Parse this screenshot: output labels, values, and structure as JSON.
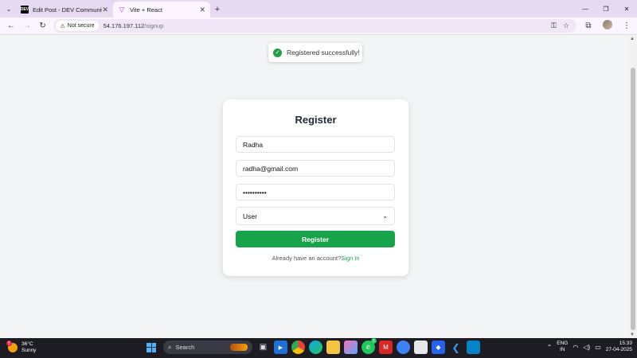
{
  "browser": {
    "tabs": [
      {
        "title": "Edit Post - DEV Community",
        "favicon": "DEV"
      },
      {
        "title": "Vite + React",
        "favicon": "vite-icon"
      }
    ],
    "address": {
      "security_label": "Not secure",
      "host": "54.176.197.112",
      "path": "/signup"
    }
  },
  "toast": {
    "message": "Registered successfully!"
  },
  "form": {
    "title": "Register",
    "name_value": "Radha",
    "email_value": "radha@gmail.com",
    "password_value": "••••••••••",
    "role_value": "User",
    "submit_label": "Register",
    "signin_prompt": "Already have an account?",
    "signin_link": "Sign In"
  },
  "taskbar": {
    "weather_badge": "5",
    "temperature": "36°C",
    "condition": "Sunny",
    "search_label": "Search",
    "whatsapp_badge": "5",
    "lang_line1": "ENG",
    "lang_line2": "IN",
    "time": "15:33",
    "date": "27-04-2025"
  },
  "colors": {
    "accent_green": "#16a34a",
    "tabstrip": "#e6d9f2",
    "taskbar": "#1c1c22"
  }
}
